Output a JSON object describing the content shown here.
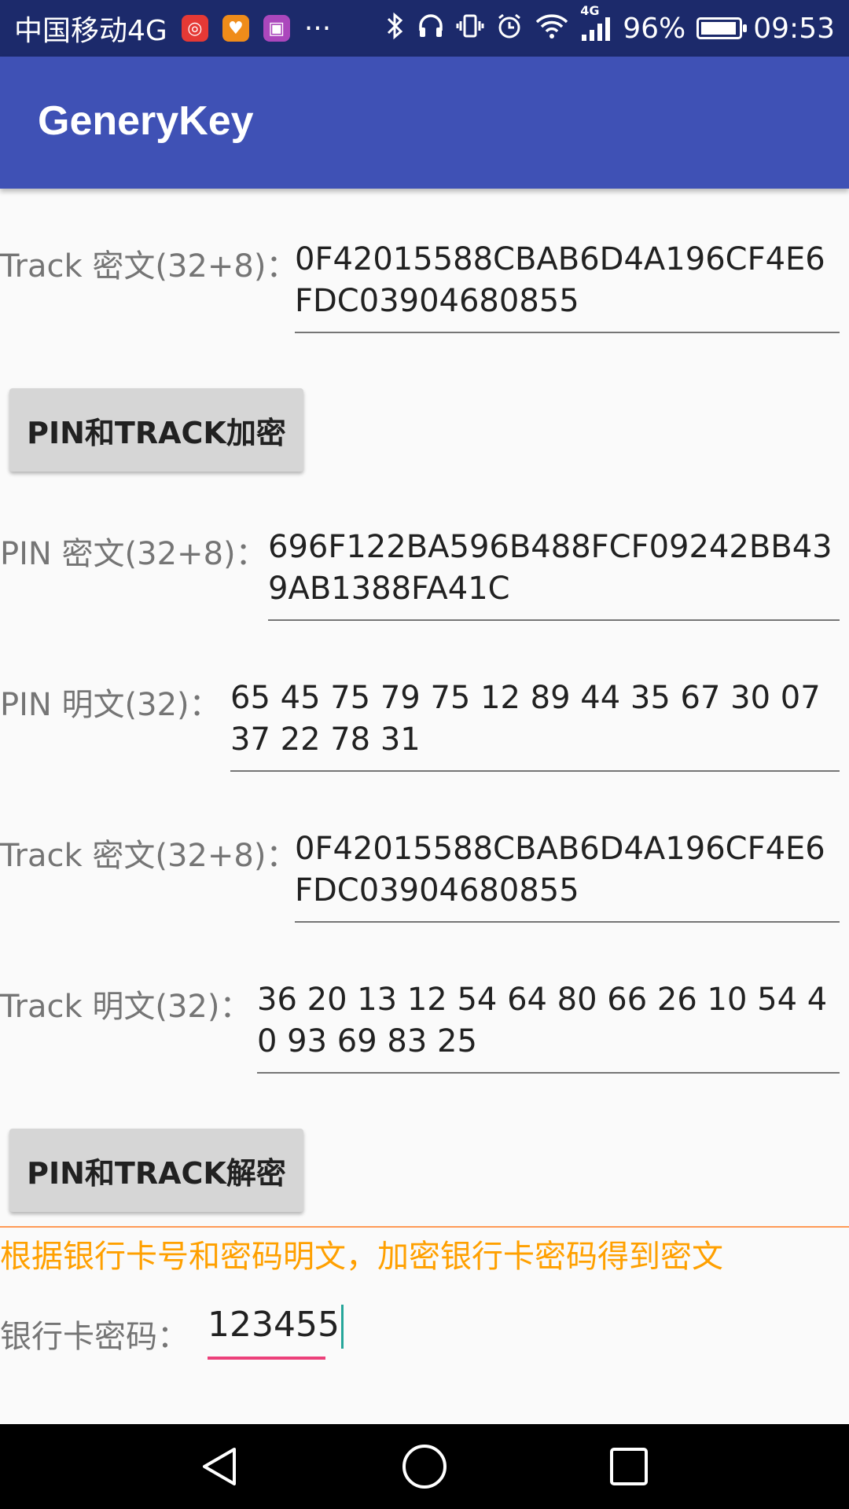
{
  "status_bar": {
    "carrier": "中国移动4G",
    "notification_icons": [
      "netease-music-icon",
      "app-orange-icon",
      "gallery-icon"
    ],
    "more": "···",
    "network_tag": "4G",
    "battery_percent": "96%",
    "battery_level": 0.96,
    "time": "09:53"
  },
  "app_bar": {
    "title": "GeneryKey"
  },
  "rows": {
    "track_cipher_1": {
      "label": "Track 密文(32+8)：",
      "value": "0F42015588CBAB6D4A196CF4E6FDC03904680855"
    },
    "encrypt_button": {
      "label": "PIN和TRACK加密"
    },
    "pin_cipher": {
      "label": "PIN 密文(32+8)：",
      "value": "696F122BA596B488FCF09242BB439AB1388FA41C"
    },
    "pin_plain": {
      "label": "PIN 明文(32)：",
      "value": "65 45 75 79 75 12 89 44 35 67 30 07 37 22 78 31"
    },
    "track_cipher_2": {
      "label": "Track 密文(32+8)：",
      "value": "0F42015588CBAB6D4A196CF4E6FDC03904680855"
    },
    "track_plain": {
      "label": "Track 明文(32)：",
      "value": "36 20 13 12 54 64 80 66 26 10 54 40 93 69 83 25"
    },
    "decrypt_button": {
      "label": "PIN和TRACK解密"
    }
  },
  "bank_section": {
    "hint": "根据银行卡号和密码明文，加密银行卡密码得到密文",
    "pin_label": "银行卡密码：",
    "pin_value": "123455"
  },
  "colors": {
    "app_bar": "#3f51b5",
    "status_bar": "#1c2a6b",
    "hint": "#ffa000",
    "focus_underline": "#ec407a",
    "divider": "#ff9a56"
  }
}
